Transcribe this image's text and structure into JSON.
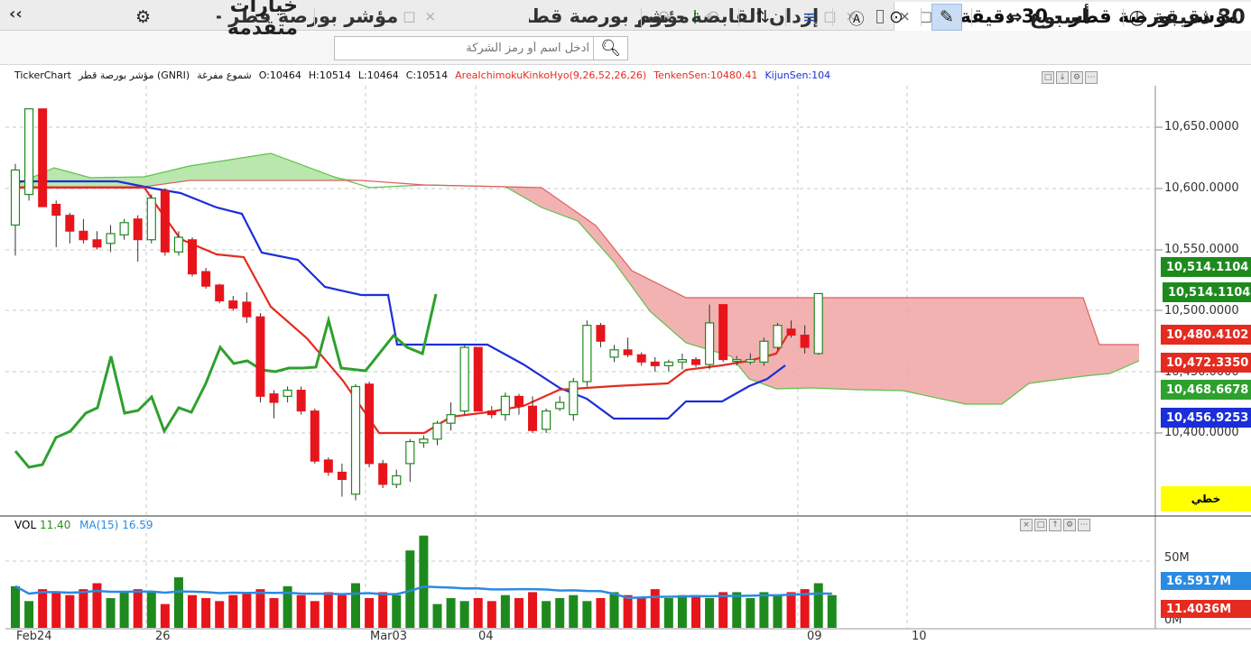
{
  "tabs": [
    {
      "label": "مؤشر بورصة قطر - 30 دقيقة",
      "active": true
    },
    {
      "label": "إزدان القابضة - يوم",
      "active": false
    },
    {
      "label": "مؤشر بورصة قطر - يوم",
      "active": false
    },
    {
      "label": "",
      "active": false
    }
  ],
  "collapse_label": "‹‹",
  "toolbar": {
    "interval_label": "30 دقيقة",
    "range_label": "أسبوع",
    "search_placeholder": "ادخل اسم أو رمز الشركة",
    "advanced_options_label": "خيارات متقدمة"
  },
  "info": {
    "source": "TickerChart",
    "symbol": "مؤشر بورصة قطر (GNRI)",
    "chart_style": "شموع مفرغة",
    "open": "O:10464",
    "high": "H:10514",
    "low": "L:10464",
    "close": "C:10514",
    "indicator": "AreaIchimokuKinkoHyo(9,26,52,26,26)",
    "tenkan": "TenkenSen:10480.41",
    "kijun": "KijunSen:104"
  },
  "volume_info": {
    "label": "VOL",
    "value": "11.40",
    "ma_label": "MA(15)",
    "ma_value": "16.59"
  },
  "price_axis": {
    "ticks": [
      "10,650.0000",
      "10,600.0000",
      "10,550.0000",
      "10,500.0000",
      "10,450.0000",
      "10,400.0000"
    ],
    "tags": [
      {
        "text": "10,514.1104",
        "color": "#1e8a1e"
      },
      {
        "text": "10,514.1104",
        "color": "#1e8a1e"
      },
      {
        "text": "10,480.4102",
        "color": "#e52b1f"
      },
      {
        "text": "10,472.3350",
        "color": "#e52b1f"
      },
      {
        "text": "10,468.6678",
        "color": "#2ea02e"
      },
      {
        "text": "10,456.9253",
        "color": "#1b2ed9"
      }
    ],
    "chat_label": "خطي"
  },
  "volume_axis": {
    "ticks": [
      "50M",
      "0M"
    ],
    "tags": [
      {
        "text": "16.5917M",
        "color": "#2b8be0"
      },
      {
        "text": "11.4036M",
        "color": "#e52b1f"
      }
    ]
  },
  "x_axis": {
    "labels": [
      "Feb24",
      "26",
      "Mar03",
      "04",
      "09",
      "10"
    ]
  },
  "chart_data": {
    "type": "candlestick",
    "title": "",
    "ylim": [
      10280,
      10680
    ],
    "candles": [
      {
        "o": 10570,
        "h": 10620,
        "l": 10545,
        "c": 10615,
        "dir": "up"
      },
      {
        "o": 10595,
        "h": 10665,
        "l": 10590,
        "c": 10665,
        "dir": "up"
      },
      {
        "o": 10665,
        "h": 10665,
        "l": 10585,
        "c": 10585,
        "dir": "down"
      },
      {
        "o": 10587,
        "h": 10590,
        "l": 10552,
        "c": 10578,
        "dir": "down"
      },
      {
        "o": 10578,
        "h": 10580,
        "l": 10555,
        "c": 10565,
        "dir": "down"
      },
      {
        "o": 10565,
        "h": 10575,
        "l": 10555,
        "c": 10558,
        "dir": "down"
      },
      {
        "o": 10558,
        "h": 10565,
        "l": 10550,
        "c": 10552,
        "dir": "down"
      },
      {
        "o": 10555,
        "h": 10570,
        "l": 10548,
        "c": 10563,
        "dir": "up"
      },
      {
        "o": 10562,
        "h": 10575,
        "l": 10558,
        "c": 10572,
        "dir": "up"
      },
      {
        "o": 10575,
        "h": 10578,
        "l": 10540,
        "c": 10558,
        "dir": "down"
      },
      {
        "o": 10558,
        "h": 10595,
        "l": 10555,
        "c": 10592,
        "dir": "up"
      },
      {
        "o": 10598,
        "h": 10600,
        "l": 10545,
        "c": 10548,
        "dir": "down"
      },
      {
        "o": 10548,
        "h": 10565,
        "l": 10545,
        "c": 10560,
        "dir": "up"
      },
      {
        "o": 10558,
        "h": 10560,
        "l": 10528,
        "c": 10530,
        "dir": "down"
      },
      {
        "o": 10532,
        "h": 10535,
        "l": 10518,
        "c": 10520,
        "dir": "down"
      },
      {
        "o": 10521,
        "h": 10522,
        "l": 10506,
        "c": 10508,
        "dir": "down"
      },
      {
        "o": 10508,
        "h": 10512,
        "l": 10500,
        "c": 10502,
        "dir": "down"
      },
      {
        "o": 10507,
        "h": 10515,
        "l": 10490,
        "c": 10495,
        "dir": "down"
      },
      {
        "o": 10495,
        "h": 10498,
        "l": 10425,
        "c": 10430,
        "dir": "down"
      },
      {
        "o": 10432,
        "h": 10435,
        "l": 10412,
        "c": 10425,
        "dir": "down"
      },
      {
        "o": 10430,
        "h": 10438,
        "l": 10425,
        "c": 10435,
        "dir": "up"
      },
      {
        "o": 10435,
        "h": 10438,
        "l": 10415,
        "c": 10418,
        "dir": "down"
      },
      {
        "o": 10418,
        "h": 10420,
        "l": 10375,
        "c": 10377,
        "dir": "down"
      },
      {
        "o": 10378,
        "h": 10380,
        "l": 10365,
        "c": 10368,
        "dir": "down"
      },
      {
        "o": 10368,
        "h": 10375,
        "l": 10348,
        "c": 10362,
        "dir": "down"
      },
      {
        "o": 10350,
        "h": 10440,
        "l": 10345,
        "c": 10438,
        "dir": "up"
      },
      {
        "o": 10440,
        "h": 10442,
        "l": 10372,
        "c": 10375,
        "dir": "down"
      },
      {
        "o": 10375,
        "h": 10378,
        "l": 10355,
        "c": 10358,
        "dir": "down"
      },
      {
        "o": 10358,
        "h": 10370,
        "l": 10355,
        "c": 10365,
        "dir": "up"
      },
      {
        "o": 10375,
        "h": 10395,
        "l": 10360,
        "c": 10393,
        "dir": "up"
      },
      {
        "o": 10392,
        "h": 10398,
        "l": 10388,
        "c": 10395,
        "dir": "up"
      },
      {
        "o": 10395,
        "h": 10410,
        "l": 10390,
        "c": 10408,
        "dir": "up"
      },
      {
        "o": 10408,
        "h": 10425,
        "l": 10402,
        "c": 10415,
        "dir": "up"
      },
      {
        "o": 10418,
        "h": 10472,
        "l": 10415,
        "c": 10470,
        "dir": "up"
      },
      {
        "o": 10470,
        "h": 10470,
        "l": 10418,
        "c": 10418,
        "dir": "down"
      },
      {
        "o": 10418,
        "h": 10422,
        "l": 10412,
        "c": 10415,
        "dir": "down"
      },
      {
        "o": 10415,
        "h": 10433,
        "l": 10410,
        "c": 10430,
        "dir": "up"
      },
      {
        "o": 10430,
        "h": 10432,
        "l": 10415,
        "c": 10422,
        "dir": "down"
      },
      {
        "o": 10422,
        "h": 10430,
        "l": 10400,
        "c": 10402,
        "dir": "down"
      },
      {
        "o": 10403,
        "h": 10420,
        "l": 10400,
        "c": 10418,
        "dir": "up"
      },
      {
        "o": 10420,
        "h": 10430,
        "l": 10418,
        "c": 10425,
        "dir": "up"
      },
      {
        "o": 10415,
        "h": 10445,
        "l": 10410,
        "c": 10442,
        "dir": "up"
      },
      {
        "o": 10442,
        "h": 10492,
        "l": 10438,
        "c": 10488,
        "dir": "up"
      },
      {
        "o": 10488,
        "h": 10490,
        "l": 10470,
        "c": 10475,
        "dir": "down"
      },
      {
        "o": 10462,
        "h": 10472,
        "l": 10458,
        "c": 10468,
        "dir": "up"
      },
      {
        "o": 10468,
        "h": 10478,
        "l": 10462,
        "c": 10464,
        "dir": "down"
      },
      {
        "o": 10464,
        "h": 10466,
        "l": 10455,
        "c": 10458,
        "dir": "down"
      },
      {
        "o": 10458,
        "h": 10462,
        "l": 10450,
        "c": 10455,
        "dir": "down"
      },
      {
        "o": 10455,
        "h": 10460,
        "l": 10450,
        "c": 10458,
        "dir": "up"
      },
      {
        "o": 10458,
        "h": 10465,
        "l": 10452,
        "c": 10460,
        "dir": "up"
      },
      {
        "o": 10460,
        "h": 10462,
        "l": 10454,
        "c": 10456,
        "dir": "down"
      },
      {
        "o": 10456,
        "h": 10505,
        "l": 10452,
        "c": 10490,
        "dir": "up"
      },
      {
        "o": 10505,
        "h": 10505,
        "l": 10458,
        "c": 10460,
        "dir": "down"
      },
      {
        "o": 10460,
        "h": 10463,
        "l": 10455,
        "c": 10460,
        "dir": "up"
      },
      {
        "o": 10460,
        "h": 10465,
        "l": 10456,
        "c": 10458,
        "dir": "up"
      },
      {
        "o": 10458,
        "h": 10478,
        "l": 10455,
        "c": 10475,
        "dir": "up"
      },
      {
        "o": 10470,
        "h": 10490,
        "l": 10468,
        "c": 10488,
        "dir": "up"
      },
      {
        "o": 10485,
        "h": 10492,
        "l": 10478,
        "c": 10480,
        "dir": "down"
      },
      {
        "o": 10480,
        "h": 10488,
        "l": 10465,
        "c": 10470,
        "dir": "down"
      },
      {
        "o": 10465,
        "h": 10514,
        "l": 10464,
        "c": 10514,
        "dir": "up"
      }
    ],
    "volume": [
      14,
      9,
      13,
      12,
      11,
      13,
      15,
      10,
      12,
      13,
      12,
      8,
      17,
      11,
      10,
      9,
      11,
      12,
      13,
      10,
      14,
      11,
      9,
      12,
      11,
      15,
      10,
      12,
      11,
      26,
      31,
      8,
      10,
      9,
      10,
      9,
      11,
      10,
      12,
      9,
      10,
      11,
      9,
      10,
      12,
      11,
      10,
      13,
      10,
      11,
      11,
      10,
      12,
      12,
      10,
      12,
      11,
      12,
      13,
      15,
      11
    ]
  }
}
